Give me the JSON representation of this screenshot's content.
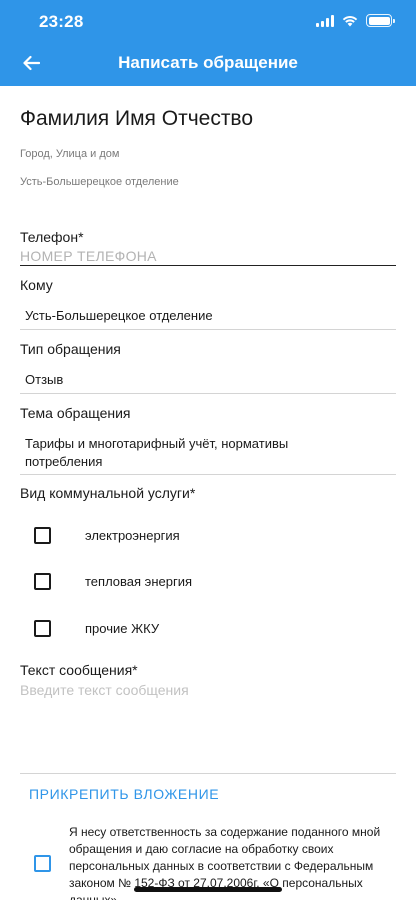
{
  "status_bar": {
    "time": "23:28"
  },
  "header": {
    "title": "Написать обращение"
  },
  "profile": {
    "full_name": "Фамилия Имя Отчество",
    "address": "Город, Улица и дом",
    "department": "Усть-Большерецкое отделение"
  },
  "form": {
    "phone": {
      "label": "Телефон*",
      "placeholder": "НОМЕР ТЕЛЕФОНА",
      "value": ""
    },
    "recipient": {
      "label": "Кому",
      "value": "Усть-Большерецкое отделение"
    },
    "request_type": {
      "label": "Тип обращения",
      "value": "Отзыв"
    },
    "topic": {
      "label": "Тема обращения",
      "value": "Тарифы и многотарифный учёт, нормативы потребления"
    },
    "service_type": {
      "label": "Вид коммунальной услуги*",
      "options": [
        {
          "label": "электроэнергия",
          "checked": false
        },
        {
          "label": "тепловая энергия",
          "checked": false
        },
        {
          "label": "прочие ЖКУ",
          "checked": false
        }
      ]
    },
    "message": {
      "label": "Текст сообщения*",
      "placeholder": "Введите текст сообщения",
      "value": ""
    },
    "attach_label": "ПРИКРЕПИТЬ ВЛОЖЕНИЕ",
    "consent": {
      "checked": false,
      "text": "Я несу ответственность за содержание поданного мной обращения и даю согласие на обработку своих персональных данных в соответствии с Федеральным законом № 152-ФЗ от 27.07.2006г. «О персональных данных»"
    }
  },
  "colors": {
    "accent": "#2f95e8",
    "text": "#1a1a1a",
    "muted": "#7a7a7a",
    "placeholder": "#b3b3b3"
  }
}
